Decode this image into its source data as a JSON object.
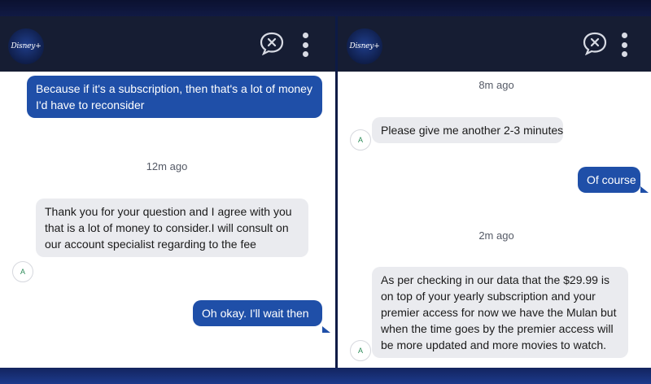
{
  "brand": {
    "logo_text": "Disney+"
  },
  "left_panel": {
    "messages": [
      {
        "sender": "user",
        "text": "Because if it's a subscription, then that's a lot of money I'd have to reconsider"
      },
      {
        "sender": "timestamp",
        "text": "12m ago"
      },
      {
        "sender": "agent",
        "avatar": "A",
        "text": "Thank you for your question and I agree with you that is a lot of money to consider.I will consult on our account specialist regarding to the fee"
      },
      {
        "sender": "user",
        "text": "Oh okay. I'll wait then"
      }
    ]
  },
  "right_panel": {
    "messages": [
      {
        "sender": "timestamp",
        "text": "8m ago"
      },
      {
        "sender": "agent",
        "avatar": "A",
        "text": "Please give me another 2-3 minutes"
      },
      {
        "sender": "user",
        "text": "Of course"
      },
      {
        "sender": "timestamp",
        "text": "2m ago"
      },
      {
        "sender": "agent",
        "avatar": "A",
        "text": "As per checking in our data that the $29.99 is on top of your yearly subscription and your premier access for now we have the Mulan but when the time goes by the premier access will be more updated and more movies to watch."
      }
    ]
  },
  "colors": {
    "user_bubble": "#1f4fa8",
    "agent_bubble": "#eaebef",
    "header": "#161d33",
    "avatar_text": "#2b8a57"
  },
  "icons": {
    "close": "close-chat-icon",
    "menu": "more-vertical-icon",
    "logo": "disney-plus-logo"
  }
}
